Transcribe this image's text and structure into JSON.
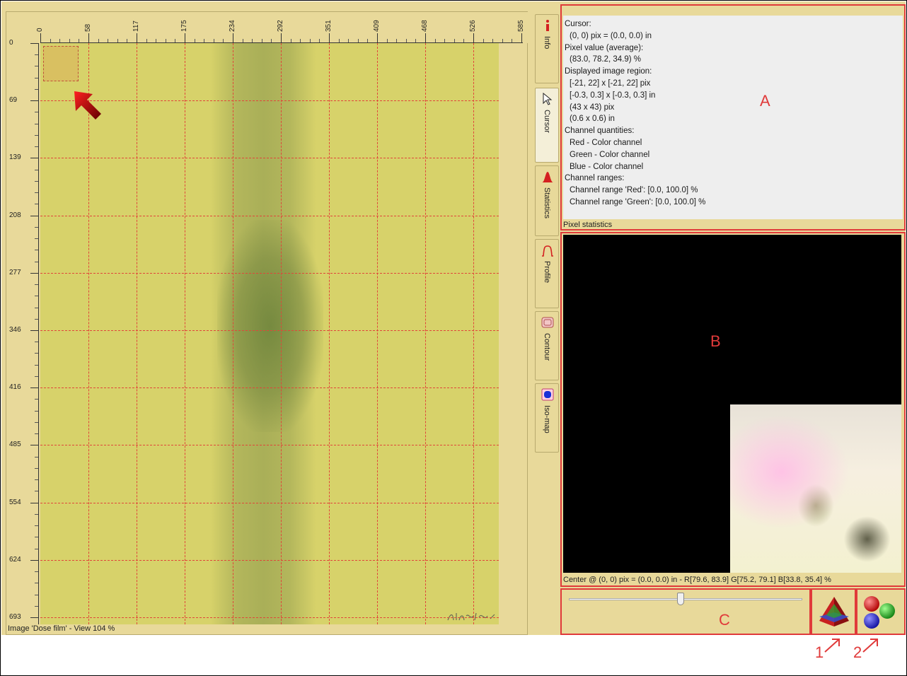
{
  "image_panel": {
    "x_ticks": [
      "0",
      "58",
      "117",
      "175",
      "234",
      "292",
      "351",
      "409",
      "468",
      "526",
      "585"
    ],
    "y_ticks": [
      "0",
      "69",
      "139",
      "208",
      "277",
      "346",
      "416",
      "485",
      "554",
      "624",
      "693"
    ],
    "status": "Image 'Dose film' - View  104 %",
    "signature": "Illegible handwriting"
  },
  "tabs": [
    {
      "label": "Info",
      "icon": "info-icon"
    },
    {
      "label": "Cursor",
      "icon": "cursor-icon"
    },
    {
      "label": "Statistics",
      "icon": "statistics-icon"
    },
    {
      "label": "Profile",
      "icon": "profile-icon"
    },
    {
      "label": "Contour",
      "icon": "contour-icon"
    },
    {
      "label": "Iso-map",
      "icon": "isomap-icon"
    }
  ],
  "info_panel": {
    "lines": [
      {
        "text": "Cursor:",
        "indent": false
      },
      {
        "text": "(0, 0) pix = (0.0, 0.0) in",
        "indent": true
      },
      {
        "text": "Pixel value (average):",
        "indent": false
      },
      {
        "text": "(83.0, 78.2, 34.9) %",
        "indent": true
      },
      {
        "text": "Displayed image region:",
        "indent": false
      },
      {
        "text": "[-21, 22] x [-21, 22] pix",
        "indent": true
      },
      {
        "text": "[-0.3, 0.3] x [-0.3, 0.3] in",
        "indent": true
      },
      {
        "text": "(43 x 43) pix",
        "indent": true
      },
      {
        "text": "(0.6 x 0.6) in",
        "indent": true
      },
      {
        "text": "Channel quantities:",
        "indent": false
      },
      {
        "text": "Red - Color channel",
        "indent": true
      },
      {
        "text": "Green - Color channel",
        "indent": true
      },
      {
        "text": "Blue - Color channel",
        "indent": true
      },
      {
        "text": "Channel ranges:",
        "indent": false
      },
      {
        "text": "Channel range 'Red':  [0.0, 100.0] %",
        "indent": true
      },
      {
        "text": "Channel range 'Green':  [0.0, 100.0] %",
        "indent": true
      }
    ],
    "caption": "Pixel statistics"
  },
  "preview_panel": {
    "status": "Center @ (0, 0) pix = (0.0, 0.0) in - R[79.6, 83.9]  G[75.2, 79.1]  B[33.8, 35.4]  %"
  },
  "zoom_slider": {
    "value_fraction": 0.48
  },
  "annotations": {
    "a": "A",
    "b": "B",
    "c": "C",
    "one": "1",
    "two": "2"
  },
  "colors": {
    "accent_red": "#e03a3a",
    "panel_bg": "#e8d99a",
    "film": "#d7d26a"
  }
}
